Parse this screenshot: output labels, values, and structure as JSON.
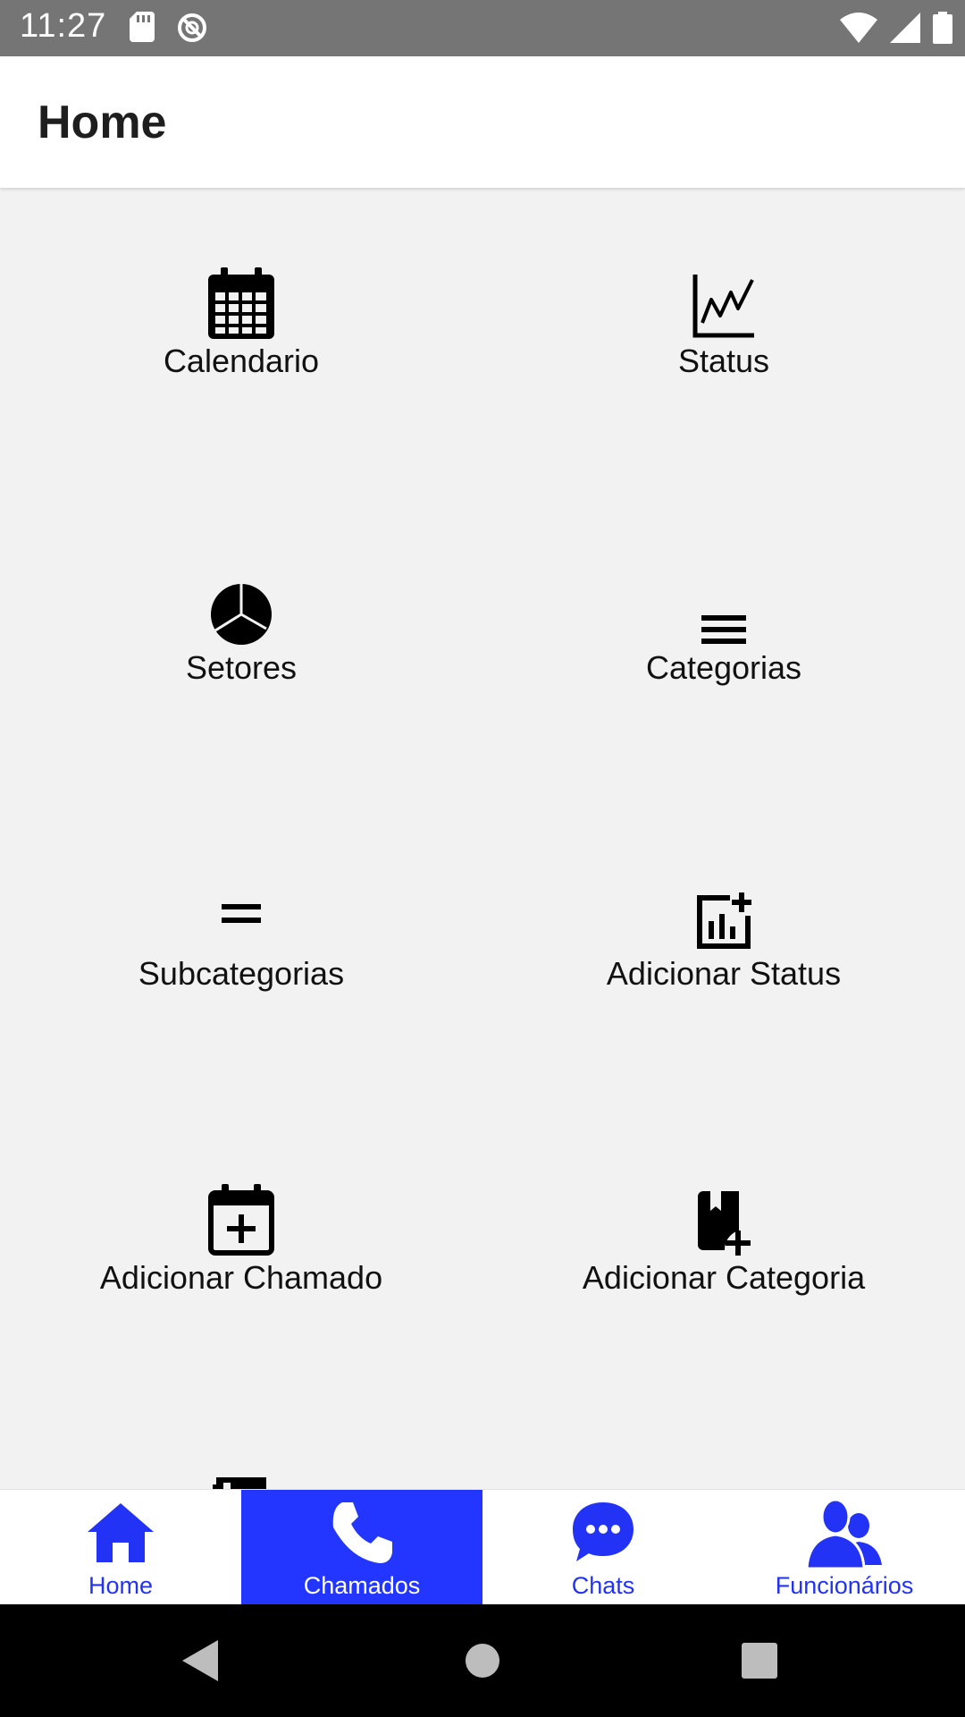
{
  "status_bar": {
    "time": "11:27",
    "icons": [
      "sd-card-icon",
      "sync-disabled-icon",
      "wifi-icon",
      "signal-icon",
      "battery-icon"
    ]
  },
  "app_bar": {
    "title": "Home"
  },
  "tiles": [
    {
      "label": "Calendario",
      "icon": "calendar-icon"
    },
    {
      "label": "Status",
      "icon": "line-chart-icon"
    },
    {
      "label": "Setores",
      "icon": "pie-chart-icon"
    },
    {
      "label": "Categorias",
      "icon": "list-icon"
    },
    {
      "label": "Subcategorias",
      "icon": "equals-icon"
    },
    {
      "label": "Adicionar Status",
      "icon": "add-chart-icon"
    },
    {
      "label": "Adicionar Chamado",
      "icon": "calendar-plus-icon"
    },
    {
      "label": "Adicionar Categoria",
      "icon": "book-plus-icon"
    }
  ],
  "bottom_nav": {
    "items": [
      {
        "label": "Home",
        "icon": "home-icon",
        "active": false
      },
      {
        "label": "Chamados",
        "icon": "phone-icon",
        "active": true
      },
      {
        "label": "Chats",
        "icon": "chat-icon",
        "active": false
      },
      {
        "label": "Funcionários",
        "icon": "users-icon",
        "active": false
      }
    ]
  },
  "colors": {
    "accent": "#2236ff",
    "status_bar": "#757575",
    "background": "#f2f2f2"
  }
}
